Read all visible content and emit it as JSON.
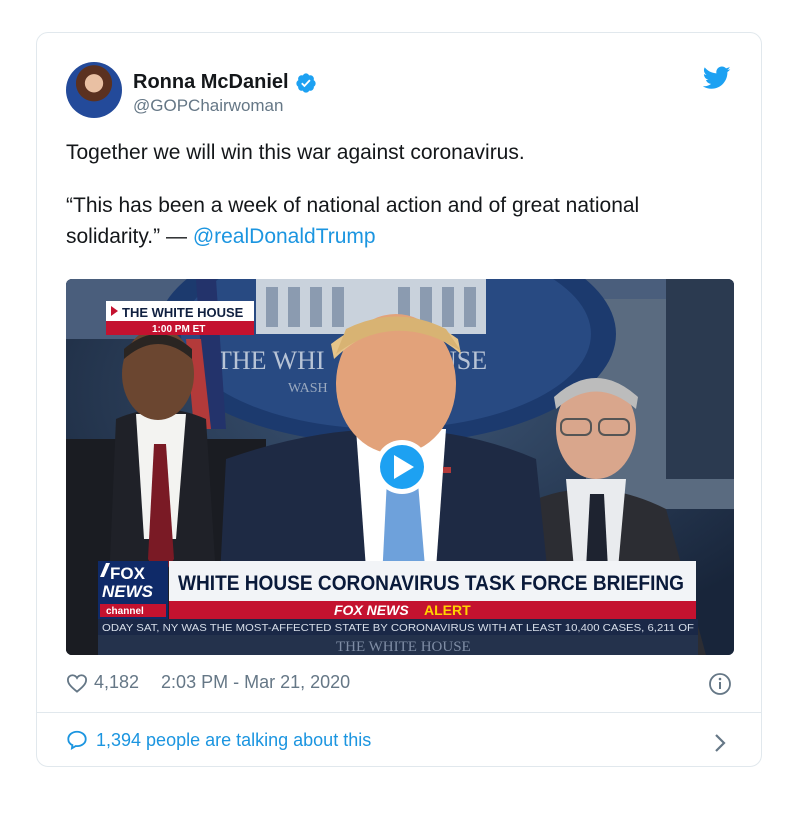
{
  "tweet": {
    "author": {
      "name": "Ronna McDaniel",
      "handle": "@GOPChairwoman"
    },
    "text_line1": "Together we will win this war against coronavirus.",
    "quote": "“This has been a week of national action and of great national solidarity.” —",
    "mention": "@realDonaldTrump",
    "likes": "4,182",
    "timestamp": "2:03 PM - Mar 21, 2020",
    "talking": "1,394 people are talking about this"
  },
  "media": {
    "bug_title": "THE WHITE HOUSE",
    "bug_time": "1:00 PM ET",
    "seal_text": "THE WHI",
    "seal_text_right": "USE",
    "seal_sub": "WASH",
    "logo_top": "FOX",
    "logo_mid": "NEWS",
    "logo_bottom": "channel",
    "headline": "WHITE HOUSE CORONAVIRUS TASK FORCE BRIEFING",
    "alert_fox": "FOX NEWS",
    "alert_word": "ALERT",
    "ticker": "ODAY SAT, NY WAS THE MOST-AFFECTED STATE BY CORONAVIRUS WITH AT LEAST 10,400 CASES, 6,211 OF",
    "podium": "THE WHITE HOUSE"
  },
  "colors": {
    "link": "#1b95e0",
    "secondary": "#657786",
    "border": "#e1e8ed",
    "fox_red": "#c4122f",
    "alert_yellow": "#ffd200"
  },
  "icons": [
    "verified-badge-icon",
    "twitter-bird-icon",
    "play-icon",
    "heart-icon",
    "info-icon",
    "comment-bubble-icon",
    "chevron-right-icon"
  ]
}
